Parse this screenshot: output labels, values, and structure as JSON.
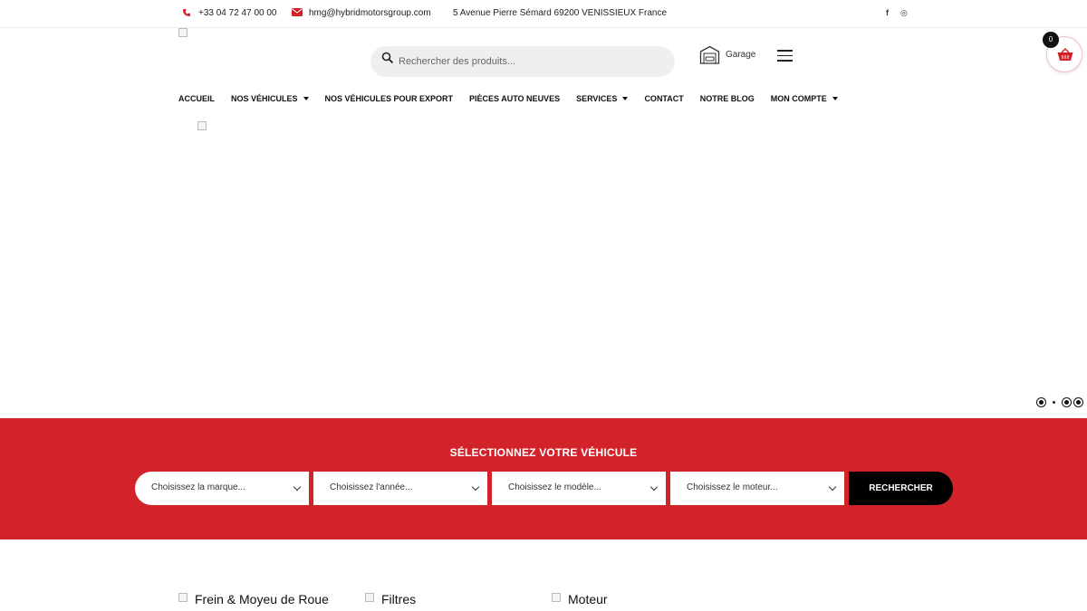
{
  "topbar": {
    "phone": "+33 04 72 47 00 00",
    "email": "hmg@hybridmotorsgroup.com",
    "address": "5 Avenue Pierre Sémard 69200 VENISSIEUX France",
    "social_facebook": "f",
    "social_instagram": "◎"
  },
  "search": {
    "placeholder": "Rechercher des produits..."
  },
  "garage": {
    "label": "Garage"
  },
  "cart": {
    "count": "0"
  },
  "nav": [
    {
      "label": "ACCUEIL",
      "has_caret": false
    },
    {
      "label": "NOS VÉHICULES",
      "has_caret": true
    },
    {
      "label": "NOS VÉHICULES POUR EXPORT",
      "has_caret": false
    },
    {
      "label": "PIÈCES AUTO NEUVES",
      "has_caret": false
    },
    {
      "label": "SERVICES",
      "has_caret": true
    },
    {
      "label": "CONTACT",
      "has_caret": false
    },
    {
      "label": "NOTRE BLOG",
      "has_caret": false
    },
    {
      "label": "MON COMPTE",
      "has_caret": true
    }
  ],
  "vehicle_selector": {
    "title": "SÉLECTIONNEZ VOTRE VÉHICULE",
    "brand": "Choisissez la marque...",
    "year": "Choisissez l'année...",
    "model": "Choisissez le modèle...",
    "engine": "Choisissez le moteur...",
    "button": "RECHERCHER"
  },
  "categories": [
    {
      "label": "Frein & Moyeu de Roue"
    },
    {
      "label": "Filtres"
    },
    {
      "label": "Moteur"
    }
  ],
  "colors": {
    "accent": "#d2232a",
    "dark": "#000000",
    "search_bg": "#efefef"
  }
}
